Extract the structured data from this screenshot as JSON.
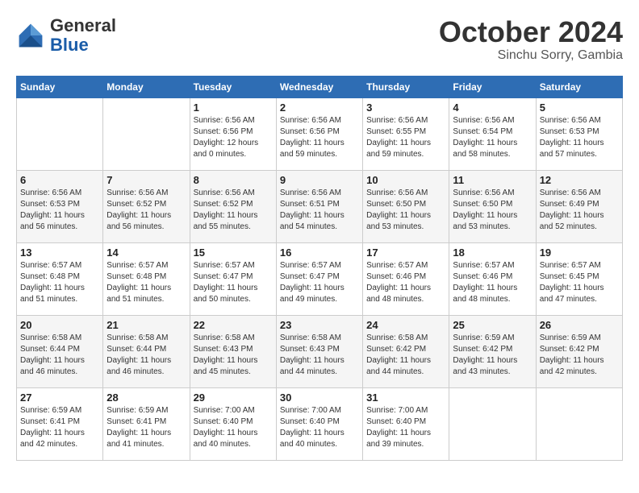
{
  "logo": {
    "general": "General",
    "blue": "Blue"
  },
  "header": {
    "month": "October 2024",
    "location": "Sinchu Sorry, Gambia"
  },
  "weekdays": [
    "Sunday",
    "Monday",
    "Tuesday",
    "Wednesday",
    "Thursday",
    "Friday",
    "Saturday"
  ],
  "weeks": [
    [
      {
        "day": "",
        "info": ""
      },
      {
        "day": "",
        "info": ""
      },
      {
        "day": "1",
        "info": "Sunrise: 6:56 AM\nSunset: 6:56 PM\nDaylight: 12 hours\nand 0 minutes."
      },
      {
        "day": "2",
        "info": "Sunrise: 6:56 AM\nSunset: 6:56 PM\nDaylight: 11 hours\nand 59 minutes."
      },
      {
        "day": "3",
        "info": "Sunrise: 6:56 AM\nSunset: 6:55 PM\nDaylight: 11 hours\nand 59 minutes."
      },
      {
        "day": "4",
        "info": "Sunrise: 6:56 AM\nSunset: 6:54 PM\nDaylight: 11 hours\nand 58 minutes."
      },
      {
        "day": "5",
        "info": "Sunrise: 6:56 AM\nSunset: 6:53 PM\nDaylight: 11 hours\nand 57 minutes."
      }
    ],
    [
      {
        "day": "6",
        "info": "Sunrise: 6:56 AM\nSunset: 6:53 PM\nDaylight: 11 hours\nand 56 minutes."
      },
      {
        "day": "7",
        "info": "Sunrise: 6:56 AM\nSunset: 6:52 PM\nDaylight: 11 hours\nand 56 minutes."
      },
      {
        "day": "8",
        "info": "Sunrise: 6:56 AM\nSunset: 6:52 PM\nDaylight: 11 hours\nand 55 minutes."
      },
      {
        "day": "9",
        "info": "Sunrise: 6:56 AM\nSunset: 6:51 PM\nDaylight: 11 hours\nand 54 minutes."
      },
      {
        "day": "10",
        "info": "Sunrise: 6:56 AM\nSunset: 6:50 PM\nDaylight: 11 hours\nand 53 minutes."
      },
      {
        "day": "11",
        "info": "Sunrise: 6:56 AM\nSunset: 6:50 PM\nDaylight: 11 hours\nand 53 minutes."
      },
      {
        "day": "12",
        "info": "Sunrise: 6:56 AM\nSunset: 6:49 PM\nDaylight: 11 hours\nand 52 minutes."
      }
    ],
    [
      {
        "day": "13",
        "info": "Sunrise: 6:57 AM\nSunset: 6:48 PM\nDaylight: 11 hours\nand 51 minutes."
      },
      {
        "day": "14",
        "info": "Sunrise: 6:57 AM\nSunset: 6:48 PM\nDaylight: 11 hours\nand 51 minutes."
      },
      {
        "day": "15",
        "info": "Sunrise: 6:57 AM\nSunset: 6:47 PM\nDaylight: 11 hours\nand 50 minutes."
      },
      {
        "day": "16",
        "info": "Sunrise: 6:57 AM\nSunset: 6:47 PM\nDaylight: 11 hours\nand 49 minutes."
      },
      {
        "day": "17",
        "info": "Sunrise: 6:57 AM\nSunset: 6:46 PM\nDaylight: 11 hours\nand 48 minutes."
      },
      {
        "day": "18",
        "info": "Sunrise: 6:57 AM\nSunset: 6:46 PM\nDaylight: 11 hours\nand 48 minutes."
      },
      {
        "day": "19",
        "info": "Sunrise: 6:57 AM\nSunset: 6:45 PM\nDaylight: 11 hours\nand 47 minutes."
      }
    ],
    [
      {
        "day": "20",
        "info": "Sunrise: 6:58 AM\nSunset: 6:44 PM\nDaylight: 11 hours\nand 46 minutes."
      },
      {
        "day": "21",
        "info": "Sunrise: 6:58 AM\nSunset: 6:44 PM\nDaylight: 11 hours\nand 46 minutes."
      },
      {
        "day": "22",
        "info": "Sunrise: 6:58 AM\nSunset: 6:43 PM\nDaylight: 11 hours\nand 45 minutes."
      },
      {
        "day": "23",
        "info": "Sunrise: 6:58 AM\nSunset: 6:43 PM\nDaylight: 11 hours\nand 44 minutes."
      },
      {
        "day": "24",
        "info": "Sunrise: 6:58 AM\nSunset: 6:42 PM\nDaylight: 11 hours\nand 44 minutes."
      },
      {
        "day": "25",
        "info": "Sunrise: 6:59 AM\nSunset: 6:42 PM\nDaylight: 11 hours\nand 43 minutes."
      },
      {
        "day": "26",
        "info": "Sunrise: 6:59 AM\nSunset: 6:42 PM\nDaylight: 11 hours\nand 42 minutes."
      }
    ],
    [
      {
        "day": "27",
        "info": "Sunrise: 6:59 AM\nSunset: 6:41 PM\nDaylight: 11 hours\nand 42 minutes."
      },
      {
        "day": "28",
        "info": "Sunrise: 6:59 AM\nSunset: 6:41 PM\nDaylight: 11 hours\nand 41 minutes."
      },
      {
        "day": "29",
        "info": "Sunrise: 7:00 AM\nSunset: 6:40 PM\nDaylight: 11 hours\nand 40 minutes."
      },
      {
        "day": "30",
        "info": "Sunrise: 7:00 AM\nSunset: 6:40 PM\nDaylight: 11 hours\nand 40 minutes."
      },
      {
        "day": "31",
        "info": "Sunrise: 7:00 AM\nSunset: 6:40 PM\nDaylight: 11 hours\nand 39 minutes."
      },
      {
        "day": "",
        "info": ""
      },
      {
        "day": "",
        "info": ""
      }
    ]
  ]
}
